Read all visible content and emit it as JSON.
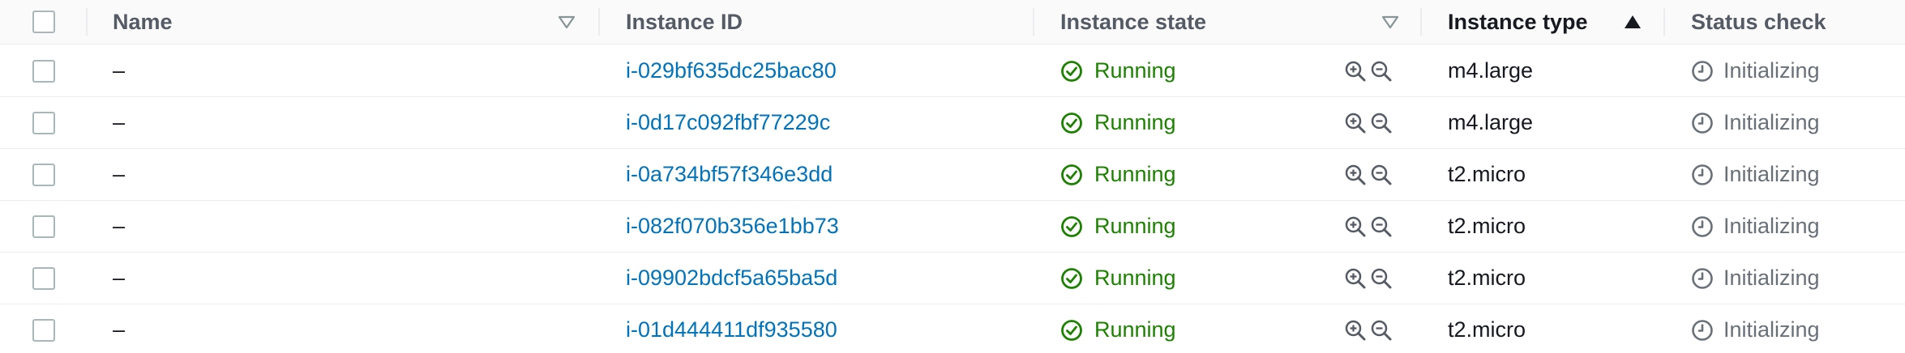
{
  "table": {
    "columns": {
      "name": "Name",
      "instance_id": "Instance ID",
      "instance_state": "Instance state",
      "instance_type": "Instance type",
      "status_check": "Status check"
    },
    "sort": {
      "column": "instance_type",
      "direction": "ascending"
    },
    "rows": [
      {
        "name": "–",
        "instance_id": "i-029bf635dc25bac80",
        "state": "Running",
        "type": "m4.large",
        "status": "Initializing"
      },
      {
        "name": "–",
        "instance_id": "i-0d17c092fbf77229c",
        "state": "Running",
        "type": "m4.large",
        "status": "Initializing"
      },
      {
        "name": "–",
        "instance_id": "i-0a734bf57f346e3dd",
        "state": "Running",
        "type": "t2.micro",
        "status": "Initializing"
      },
      {
        "name": "–",
        "instance_id": "i-082f070b356e1bb73",
        "state": "Running",
        "type": "t2.micro",
        "status": "Initializing"
      },
      {
        "name": "–",
        "instance_id": "i-09902bdcf5a65ba5d",
        "state": "Running",
        "type": "t2.micro",
        "status": "Initializing"
      },
      {
        "name": "–",
        "instance_id": "i-01d444411df935580",
        "state": "Running",
        "type": "t2.micro",
        "status": "Initializing"
      }
    ]
  },
  "icons": {
    "state": "check-circle-icon",
    "zoom_in": "zoom-in-icon",
    "zoom_out": "zoom-out-icon",
    "status": "clock-icon",
    "filter_sort": "triangle-down-icon",
    "active_sort": "triangle-up-icon"
  },
  "colors": {
    "link": "#0073bb",
    "running": "#1d8102",
    "muted": "#687078",
    "header_text": "#545b64",
    "border": "#eaeded"
  }
}
